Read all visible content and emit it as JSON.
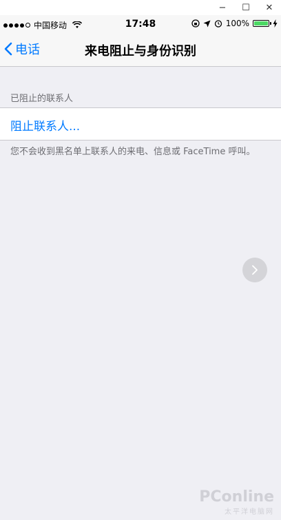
{
  "window": {
    "minimize": "−",
    "maximize": "☐",
    "close": "✕"
  },
  "status_bar": {
    "carrier": "中国移动",
    "time": "17:48",
    "battery": "100%"
  },
  "nav": {
    "back_label": "电话",
    "title": "来电阻止与身份识别"
  },
  "blocked": {
    "section_header": "已阻止的联系人",
    "block_action": "阻止联系人...",
    "footer": "您不会收到黑名单上联系人的来电、信息或 FaceTime 呼叫。"
  },
  "watermark": {
    "brand": "PConline",
    "sub": "太平洋电脑网"
  },
  "colors": {
    "accent": "#007aff",
    "background": "#efeff4",
    "battery": "#4cd964"
  }
}
